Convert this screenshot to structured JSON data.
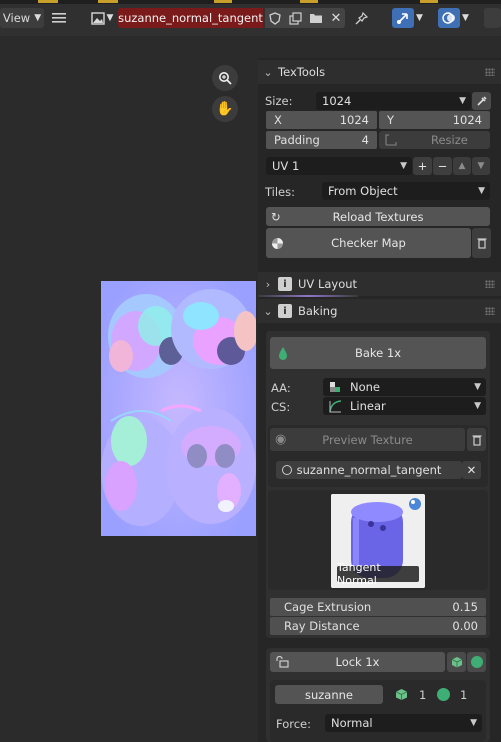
{
  "header": {
    "view_label": "View",
    "image_name": "suzanne_normal_tangent",
    "icons": [
      "hamburger-icon",
      "image-icon",
      "shield-icon",
      "duplicate-icon",
      "folder-icon",
      "close-icon",
      "pin-icon",
      "cursor-icon",
      "overlay-icon"
    ]
  },
  "panel": {
    "textools": {
      "title": "TexTools",
      "size_label": "Size:",
      "size_value": "1024",
      "x_label": "X",
      "x_value": "1024",
      "y_label": "Y",
      "y_value": "1024",
      "padding_label": "Padding",
      "padding_value": "4",
      "resize_label": "Resize",
      "uv_map": "UV 1",
      "tiles_label": "Tiles:",
      "tiles_value": "From Object",
      "reload_label": "Reload Textures",
      "checker_label": "Checker Map"
    },
    "uv_layout": {
      "title": "UV Layout"
    },
    "baking": {
      "title": "Baking",
      "bake_label": "Bake 1x",
      "aa_label": "AA:",
      "aa_value": "None",
      "cs_label": "CS:",
      "cs_value": "Linear",
      "preview_label": "Preview Texture",
      "texture_name": "suzanne_normal_tangent",
      "preview_caption": "Tangent Normal",
      "cage_label": "Cage Extrusion",
      "cage_value": "0.15",
      "ray_label": "Ray Distance",
      "ray_value": "0.00",
      "lock_label": "Lock 1x",
      "object_name": "suzanne",
      "mesh_count": "1",
      "sphere_count": "1",
      "force_label": "Force:",
      "force_value": "Normal"
    }
  },
  "colors": {
    "header_image_bg": "#7a1a1a",
    "active_blue": "#3f6fb5",
    "normal_map_base": "#b3a7ff"
  }
}
